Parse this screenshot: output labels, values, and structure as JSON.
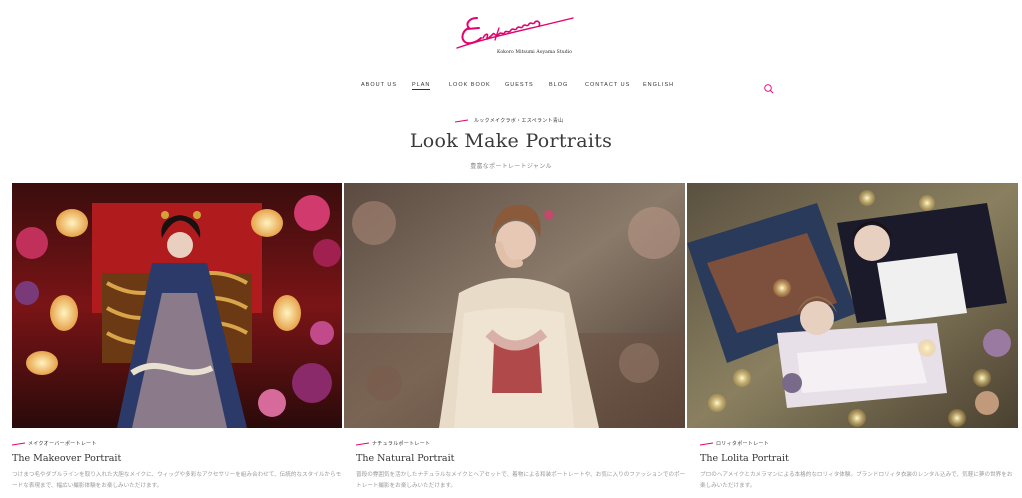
{
  "brand": {
    "logo_text": "Esperanto",
    "subtitle": "Kokoro Mitsumi Aoyama Studio",
    "accent_color": "#e3006f"
  },
  "nav": {
    "items": [
      {
        "label": "ABOUT US",
        "active": false
      },
      {
        "label": "PLAN",
        "active": true
      },
      {
        "label": "LOOK BOOK",
        "active": false
      },
      {
        "label": "GUESTS",
        "active": false
      },
      {
        "label": "BLOG",
        "active": false
      },
      {
        "label": "CONTACT US",
        "active": false
      },
      {
        "label": "ENGLISH",
        "active": false
      }
    ],
    "search_icon": "search-icon"
  },
  "section": {
    "eyebrow": "ルックメイクラボ・エスペラント青山",
    "title": "Look Make Portraits",
    "subtitle": "豊富なポートレートジャンル"
  },
  "cards": [
    {
      "tag": "メイクオーバーポートレート",
      "title": "The Makeover Portrait",
      "desc": "つけまつ毛やダブルラインを取り入れた大胆なメイクに、ウィッグや多彩なアクセサリーを組み合わせて、伝統的なスタイルからモードな表現まで、幅広い撮影体験をお楽しみいただけます。"
    },
    {
      "tag": "ナチュラルポートレート",
      "title": "The Natural Portrait",
      "desc": "普段の雰囲気を活かしたナチュラルなメイクとヘアセットで、着物による和装ポートレートや、お気に入りのファッションでのポートレート撮影をお楽しみいただけます。"
    },
    {
      "tag": "ロリィタポートレート",
      "title": "The Lolita Portrait",
      "desc": "プロのヘアメイクとカメラマンによる本格的なロリィタ体験。ブランドロリィタ衣装のレンタル込みで、気軽に夢の世界をお楽しみいただけます。"
    }
  ]
}
